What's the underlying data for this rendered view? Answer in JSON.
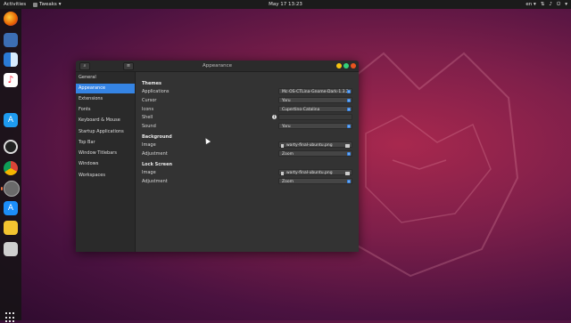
{
  "topbar": {
    "activities": "Activities",
    "app_name": "Tweaks",
    "clock": "May 17  13:23",
    "language": "en"
  },
  "dock": {
    "items": [
      {
        "name": "firefox",
        "color": "#e66000"
      },
      {
        "name": "system-monitor",
        "color": "#3c6eb4"
      },
      {
        "name": "finder",
        "color": "#2b7bd6"
      },
      {
        "name": "music",
        "color": "#fa233b"
      },
      {
        "name": "app-store",
        "color": "#1e9bf0"
      },
      {
        "name": "settings-gear",
        "color": "#d8d8d8"
      },
      {
        "name": "chrome",
        "color": "#4285f4"
      },
      {
        "name": "tweaks",
        "color": "#6a6a6a"
      },
      {
        "name": "software",
        "color": "#1c8ef9"
      },
      {
        "name": "notes",
        "color": "#f4c430"
      },
      {
        "name": "drive",
        "color": "#cfcfcf"
      }
    ]
  },
  "window": {
    "title": "Appearance",
    "sidebar": [
      {
        "label": "General"
      },
      {
        "label": "Appearance"
      },
      {
        "label": "Extensions"
      },
      {
        "label": "Fonts"
      },
      {
        "label": "Keyboard & Mouse"
      },
      {
        "label": "Startup Applications"
      },
      {
        "label": "Top Bar"
      },
      {
        "label": "Window Titlebars"
      },
      {
        "label": "Windows"
      },
      {
        "label": "Workspaces"
      }
    ],
    "sections": {
      "themes": {
        "heading": "Themes",
        "applications_label": "Applications",
        "applications_value": "Mc-OS-CTLina-Gnome-Dark-1.3.2",
        "cursor_label": "Cursor",
        "cursor_value": "Yaru",
        "icons_label": "Icons",
        "icons_value": "Cupertino-Catalina",
        "shell_label": "Shell",
        "shell_value": "",
        "sound_label": "Sound",
        "sound_value": "Yaru"
      },
      "background": {
        "heading": "Background",
        "image_label": "Image",
        "image_value": "warty-final-ubuntu.png",
        "adjustment_label": "Adjustment",
        "adjustment_value": "Zoom"
      },
      "lockscreen": {
        "heading": "Lock Screen",
        "image_label": "Image",
        "image_value": "warty-final-ubuntu.png",
        "adjustment_label": "Adjustment",
        "adjustment_value": "Zoom"
      }
    }
  },
  "colors": {
    "accent": "#3584e4",
    "close": "#e95420",
    "minimize": "#f5c211",
    "maximize": "#33d17a"
  }
}
